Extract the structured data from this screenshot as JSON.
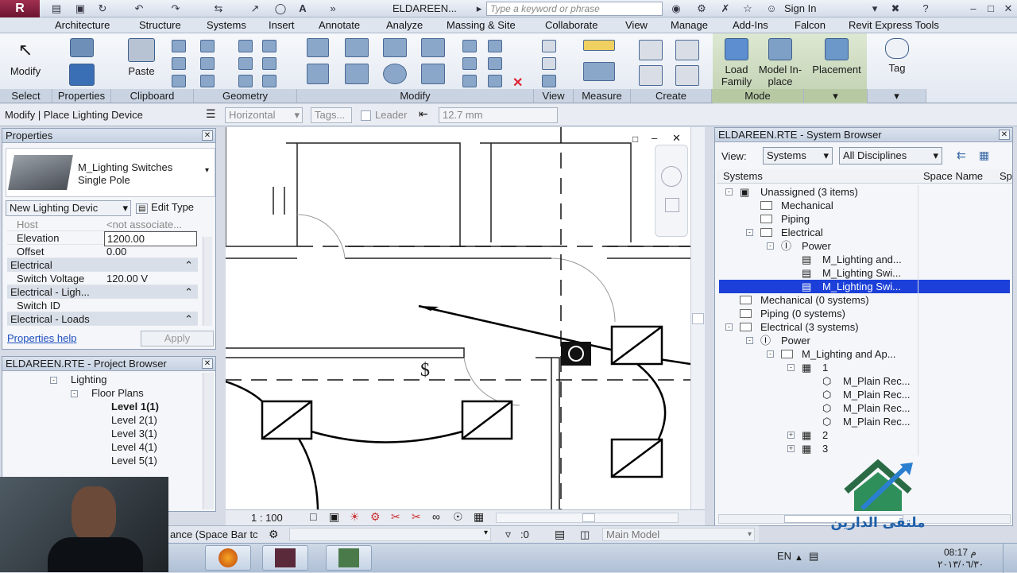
{
  "title_bar": {
    "app_button": "R",
    "document": "ELDAREEN...",
    "search_placeholder": "Type a keyword or phrase",
    "sign_in": "Sign In"
  },
  "ribbon_tabs": [
    "Architecture",
    "Structure",
    "Systems",
    "Insert",
    "Annotate",
    "Analyze",
    "Massing & Site",
    "Collaborate",
    "View",
    "Manage",
    "Add-Ins",
    "Falcon",
    "Revit Express Tools"
  ],
  "ribbon": {
    "modify_btn": "Modify",
    "paste_btn": "Paste",
    "load_family_btn": "Load Family",
    "model_inplace_btn": "Model In-place",
    "placement_btn": "Placement",
    "tag_btn": "Tag",
    "panels": [
      "Select",
      "Properties",
      "Clipboard",
      "Geometry",
      "Modify",
      "View",
      "Measure",
      "Create",
      "Mode"
    ]
  },
  "options_bar": {
    "context": "Modify | Place Lighting Device",
    "orientation": "Horizontal",
    "tags": "Tags...",
    "leader": "Leader",
    "length": "12.7 mm"
  },
  "properties": {
    "title": "Properties",
    "family": "M_Lighting Switches",
    "type": "Single Pole",
    "instance_selector": "New Lighting Devic",
    "edit_type": "Edit Type",
    "rows": [
      {
        "k": "Host",
        "v": "<not associate..."
      },
      {
        "k": "Elevation",
        "v": "1200.00"
      },
      {
        "k": "Offset",
        "v": "0.00"
      },
      {
        "k": "Electrical",
        "v": "",
        "hdr": true
      },
      {
        "k": "Switch Voltage",
        "v": "120.00 V"
      },
      {
        "k": "Electrical - Ligh...",
        "v": "",
        "hdr": true
      },
      {
        "k": "Switch ID",
        "v": ""
      },
      {
        "k": "Electrical - Loads",
        "v": "",
        "hdr": true
      }
    ],
    "help": "Properties help",
    "apply": "Apply"
  },
  "project_browser": {
    "title": "ELDAREEN.RTE - Project Browser",
    "lighting": "Lighting",
    "floor_plans": "Floor Plans",
    "levels": [
      "Level 1(1)",
      "Level 2(1)",
      "Level 3(1)",
      "Level 4(1)",
      "Level 5(1)"
    ]
  },
  "canvas": {
    "scale": "1 : 100"
  },
  "system_browser": {
    "title": "ELDAREEN.RTE - System Browser",
    "view_label": "View:",
    "view_value": "Systems",
    "discipline_value": "All Disciplines",
    "col_systems": "Systems",
    "col_space": "Space Name",
    "col_sp": "Sp",
    "rows": [
      {
        "label": "Unassigned (3 items)",
        "indent": 0,
        "exp": "-",
        "icon": "sys"
      },
      {
        "label": "Mechanical",
        "indent": 1,
        "exp": "",
        "icon": "folder"
      },
      {
        "label": "Piping",
        "indent": 1,
        "exp": "",
        "icon": "folder"
      },
      {
        "label": "Electrical",
        "indent": 1,
        "exp": "-",
        "icon": "folder"
      },
      {
        "label": "Power",
        "indent": 2,
        "exp": "-",
        "icon": "power"
      },
      {
        "label": "M_Lighting and...",
        "indent": 3,
        "exp": "",
        "icon": "dev"
      },
      {
        "label": "M_Lighting Swi...",
        "indent": 3,
        "exp": "",
        "icon": "dev"
      },
      {
        "label": "M_Lighting Swi...",
        "indent": 3,
        "exp": "",
        "icon": "dev",
        "selected": true
      },
      {
        "label": "Mechanical (0 systems)",
        "indent": 0,
        "exp": "",
        "icon": "folder"
      },
      {
        "label": "Piping (0 systems)",
        "indent": 0,
        "exp": "",
        "icon": "folder"
      },
      {
        "label": "Electrical (3 systems)",
        "indent": 0,
        "exp": "-",
        "icon": "folder"
      },
      {
        "label": "Power",
        "indent": 1,
        "exp": "-",
        "icon": "power"
      },
      {
        "label": "M_Lighting and Ap...",
        "indent": 2,
        "exp": "-",
        "icon": "folder"
      },
      {
        "label": "1",
        "indent": 3,
        "exp": "-",
        "icon": "circuit"
      },
      {
        "label": "M_Plain Rec...",
        "indent": 4,
        "exp": "",
        "icon": "plug"
      },
      {
        "label": "M_Plain Rec...",
        "indent": 4,
        "exp": "",
        "icon": "plug"
      },
      {
        "label": "M_Plain Rec...",
        "indent": 4,
        "exp": "",
        "icon": "plug"
      },
      {
        "label": "M_Plain Rec...",
        "indent": 4,
        "exp": "",
        "icon": "plug"
      },
      {
        "label": "2",
        "indent": 3,
        "exp": "+",
        "icon": "circuit"
      },
      {
        "label": "3",
        "indent": 3,
        "exp": "+",
        "icon": "circuit"
      }
    ]
  },
  "status_bar": {
    "hint": "ance (Space Bar tc",
    "sel_count": ":0",
    "model": "Main Model"
  },
  "taskbar": {
    "lang": "EN",
    "time": "08:17 م",
    "date": "٢٠١٣/٠٦/٣٠"
  },
  "watermark": {
    "text": "ملتقى الدارين"
  }
}
